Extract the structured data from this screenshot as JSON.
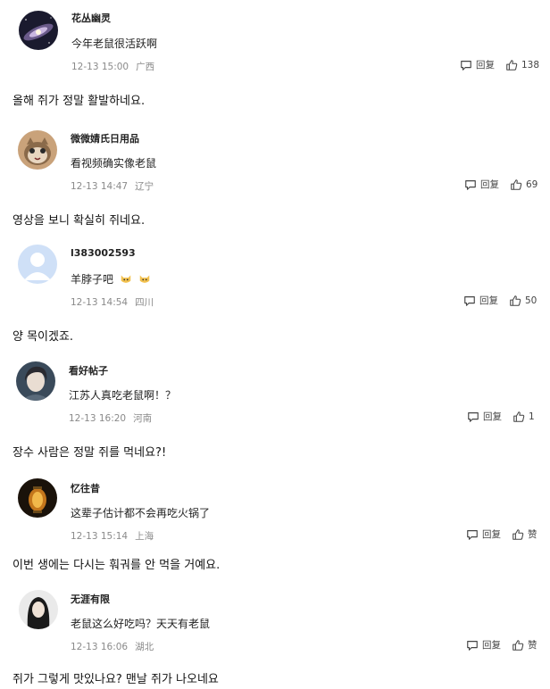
{
  "comments": [
    {
      "username": "花丛幽灵",
      "text": "今年老鼠很活跃啊",
      "time": "12-13 15:00",
      "location": "广西",
      "reply_label": "回复",
      "likes": "138",
      "translation": "올해 쥐가 정말 활발하네요."
    },
    {
      "username": "微微婧氏日用品",
      "text": "看视频确实像老鼠",
      "time": "12-13 14:47",
      "location": "辽宁",
      "reply_label": "回复",
      "likes": "69",
      "translation": "영상을 보니 확실히 쥐네요."
    },
    {
      "username": "l383002593",
      "text": "羊脖子吧",
      "time": "12-13 14:54",
      "location": "四川",
      "reply_label": "回复",
      "likes": "50",
      "translation": "양 목이겠죠."
    },
    {
      "username": "看好帖子",
      "text": "江苏人真吃老鼠啊！？",
      "time": "12-13 16:20",
      "location": "河南",
      "reply_label": "回复",
      "likes": "1",
      "translation": "장수 사람은 정말 쥐를 먹네요?!"
    },
    {
      "username": "忆往昔",
      "text": "这辈子估计都不会再吃火锅了",
      "time": "12-13 15:14",
      "location": "上海",
      "reply_label": "回复",
      "likes": "赞",
      "translation": "이번 생에는 다시는 훠궈를 안 먹을 거예요."
    },
    {
      "username": "无涯有限",
      "text": "老鼠这么好吃吗？天天有老鼠",
      "time": "12-13 16:06",
      "location": "湖北",
      "reply_label": "回复",
      "likes": "赞",
      "translation": "쥐가 그렇게 맛있나요? 맨날 쥐가 나오네요"
    }
  ],
  "icons": {
    "reply": "comment-bubble-icon",
    "like": "thumbs-up-icon",
    "emoji": "cat-face-emoji-icon"
  },
  "colors": {
    "meta_gray": "#8a8a8a",
    "text_dark": "#222222"
  }
}
